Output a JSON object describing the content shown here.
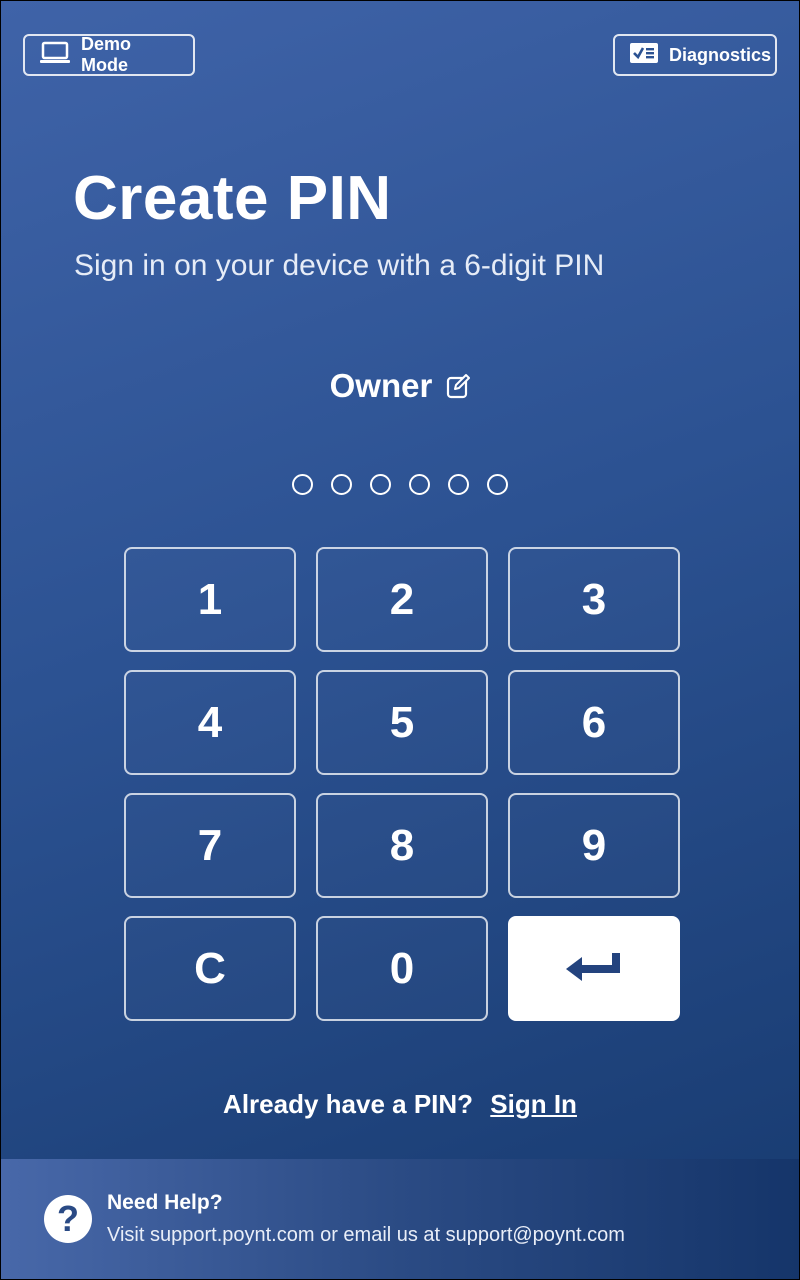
{
  "header": {
    "demo_label": "Demo Mode",
    "demo_icon": "laptop-icon",
    "diagnostics_label": "Diagnostics",
    "diagnostics_icon": "checklist-icon"
  },
  "main": {
    "title": "Create PIN",
    "subtitle": "Sign in on your device with a 6-digit PIN",
    "user_name": "Owner",
    "pin_length": 6,
    "pin_filled": 0
  },
  "keypad": {
    "keys": [
      "1",
      "2",
      "3",
      "4",
      "5",
      "6",
      "7",
      "8",
      "9",
      "C",
      "0"
    ],
    "enter_icon": "enter-icon"
  },
  "signin": {
    "prompt": "Already have a PIN?",
    "link": "Sign In"
  },
  "footer": {
    "help_title": "Need Help?",
    "help_text": "Visit support.poynt.com or email us at support@poynt.com",
    "help_icon": "question-icon"
  },
  "colors": {
    "background_top": "#3f63a8",
    "background_bottom": "#173a6f",
    "enter_arrow": "#23437e"
  }
}
